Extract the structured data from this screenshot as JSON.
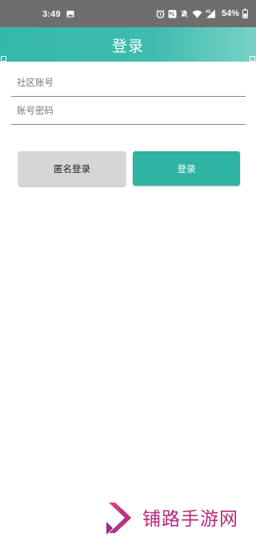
{
  "status_bar": {
    "time": "3:49",
    "battery": "54%",
    "icons": [
      "image-icon",
      "alarm-icon",
      "volte-icon",
      "mute-icon",
      "wifi-icon",
      "4g-signal-icon",
      "battery-icon"
    ]
  },
  "header": {
    "title": "登录",
    "background": "#3fbcae"
  },
  "form": {
    "account_placeholder": "社区账号",
    "password_placeholder": "账号密码",
    "account_value": "",
    "password_value": ""
  },
  "buttons": {
    "anonymous_login": "匿名登录",
    "login": "登录",
    "login_color": "#2fb3a3",
    "anonymous_color": "#d6d6d6"
  },
  "watermark": {
    "text": "铺路手游网",
    "color": "#b8297a"
  }
}
